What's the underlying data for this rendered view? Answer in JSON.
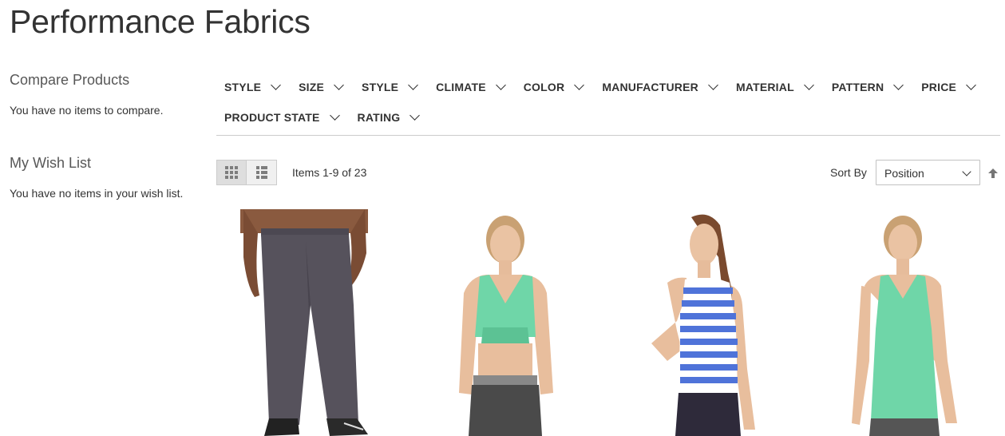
{
  "page": {
    "title": "Performance Fabrics"
  },
  "sidebar": {
    "compare": {
      "title": "Compare Products",
      "empty_text": "You have no items to compare."
    },
    "wishlist": {
      "title": "My Wish List",
      "empty_text": "You have no items in your wish list."
    }
  },
  "filters": {
    "row1": [
      "STYLE",
      "SIZE",
      "STYLE",
      "CLIMATE",
      "COLOR",
      "MANUFACTURER",
      "MATERIAL",
      "PATTERN",
      "PRICE"
    ],
    "row2": [
      "PRODUCT STATE",
      "RATING"
    ]
  },
  "toolbar": {
    "amount": "Items 1-9 of 23",
    "sort_label": "Sort By",
    "sort_selected": "Position",
    "view_modes": [
      "grid-icon",
      "list-icon"
    ],
    "sort_direction_icon": "arrow-up-icon"
  },
  "products": [
    {
      "image": "gray-pants-product-image"
    },
    {
      "image": "green-sports-bra-product-image"
    },
    {
      "image": "striped-tank-product-image"
    },
    {
      "image": "green-tank-product-image"
    }
  ],
  "colors": {
    "accent_product_green": "#6fd6a8",
    "stripe_blue": "#4f73d9",
    "pants_gray": "#56525c"
  }
}
